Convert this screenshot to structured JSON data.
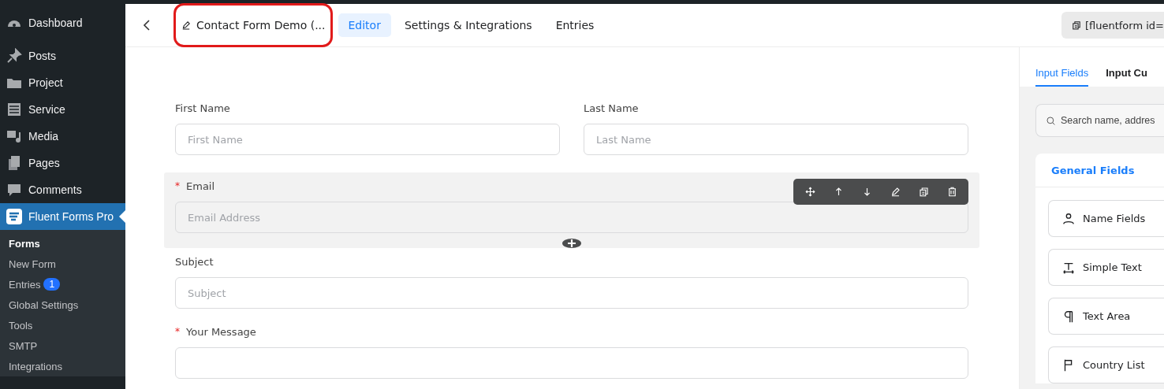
{
  "admin_menu": {
    "items": [
      {
        "label": "Dashboard",
        "selected": false
      },
      {
        "label": "Posts",
        "selected": false
      },
      {
        "label": "Project",
        "selected": false
      },
      {
        "label": "Service",
        "selected": false
      },
      {
        "label": "Media",
        "selected": false
      },
      {
        "label": "Pages",
        "selected": false
      },
      {
        "label": "Comments",
        "selected": false
      },
      {
        "label": "Fluent Forms Pro",
        "selected": true
      }
    ],
    "submenu": [
      {
        "label": "Forms",
        "selected": true
      },
      {
        "label": "New Form",
        "selected": false
      },
      {
        "label": "Entries",
        "badge": "1",
        "selected": false
      },
      {
        "label": "Global Settings",
        "selected": false
      },
      {
        "label": "Tools",
        "selected": false
      },
      {
        "label": "SMTP",
        "selected": false
      },
      {
        "label": "Integrations",
        "selected": false
      }
    ]
  },
  "header": {
    "form_title": {
      "text": "Contact Form Demo (...",
      "highlighted": true
    },
    "tabs": [
      {
        "label": "Editor",
        "selected": true
      },
      {
        "label": "Settings & Integrations",
        "selected": false
      },
      {
        "label": "Entries",
        "selected": false
      }
    ],
    "shortcode": "[fluentform id="
  },
  "form": {
    "rows": [
      {
        "selected": false,
        "fields": [
          {
            "label": "First Name",
            "placeholder": "First Name"
          },
          {
            "label": "Last Name",
            "placeholder": "Last Name"
          }
        ]
      },
      {
        "selected": true,
        "fields": [
          {
            "label": "Email",
            "placeholder": "Email Address",
            "required_mark": "*"
          }
        ]
      },
      {
        "selected": false,
        "fields": [
          {
            "label": "Subject",
            "placeholder": "Subject"
          }
        ]
      },
      {
        "selected": false,
        "fields": [
          {
            "label": "Your Message",
            "required_mark": "*"
          }
        ]
      }
    ]
  },
  "panel": {
    "tabs": [
      {
        "label": "Input Fields",
        "selected": true
      },
      {
        "label": "Input Cu",
        "selected": false
      }
    ],
    "search": {
      "placeholder": "Search name, addres"
    },
    "section": "General Fields",
    "items": [
      {
        "label": "Name Fields"
      },
      {
        "label": "Simple Text"
      },
      {
        "label": "Text Area"
      },
      {
        "label": "Country List"
      }
    ]
  }
}
